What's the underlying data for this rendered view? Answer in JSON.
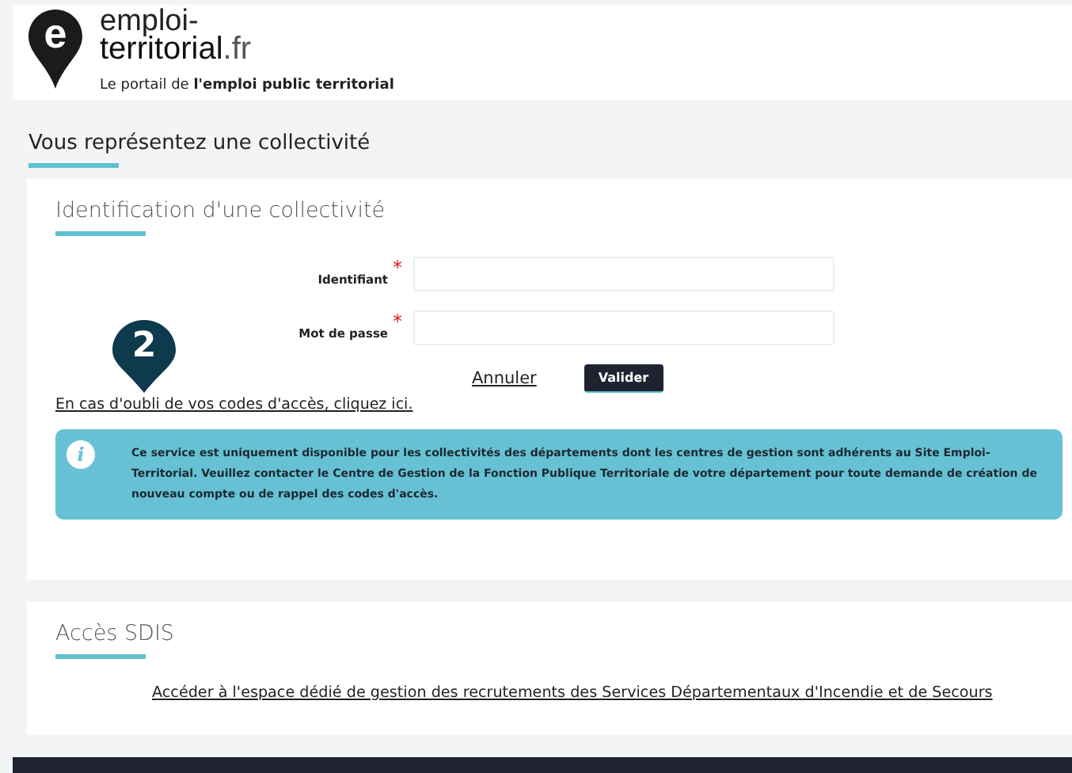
{
  "header": {
    "logo_mark": "e",
    "logo_lines": [
      "emploi-",
      "**territorial**.fr"
    ],
    "tagline": "Le portail de **l'emploi public territorial**"
  },
  "page_title": "Vous représentez une collectivité",
  "login_card": {
    "title": "Identification d'une collectivité",
    "fields": [
      {
        "label": "Identifiant",
        "required_mark": "*"
      },
      {
        "label": "Mot de passe",
        "required_mark": "*"
      }
    ],
    "cancel": "Annuler",
    "submit": "Valider",
    "forgot_link": "En cas d'oubli de vos codes d'accès, cliquez ici.",
    "info": {
      "icon": "i",
      "text": "Ce service est uniquement disponible pour les collectivités des départements dont les centres de gestion sont adhérents au Site Emploi-Territorial. Veuillez contacter le Centre de Gestion de la Fonction Publique Territoriale de votre département pour toute demande de création de nouveau compte ou de rappel des codes d'accès."
    }
  },
  "sdis_card": {
    "title": "Accès SDIS",
    "link": "Accéder à l'espace dédié de gestion des recrutements des Services Départementaux d'Incendie et de Secours"
  },
  "marker": {
    "label": "2"
  }
}
